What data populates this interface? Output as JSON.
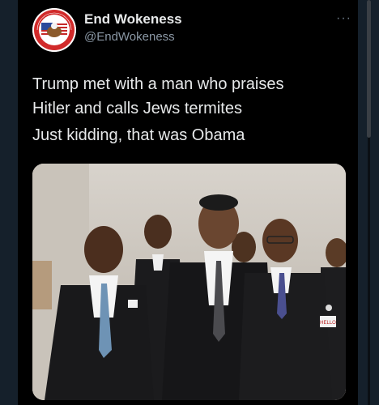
{
  "tweet": {
    "display_name": "End Wokeness",
    "handle": "@EndWokeness",
    "more_label": "···",
    "text_line_1": "Trump met with a man who praises",
    "text_line_2": "Hitler and calls Jews termites",
    "text_line_3": "Just kidding, that was Obama"
  },
  "avatar": {
    "badge_text_top": "I SUPPORT THE",
    "badge_text_bottom": "FARMER THINGS"
  },
  "media": {
    "photo_subject": "five-men-suits-photo",
    "name_tag_text": "HELLO"
  },
  "colors": {
    "background": "#000000",
    "text_primary": "#e7e9ea",
    "text_secondary": "#8b98a5",
    "chrome": "#15202b"
  }
}
